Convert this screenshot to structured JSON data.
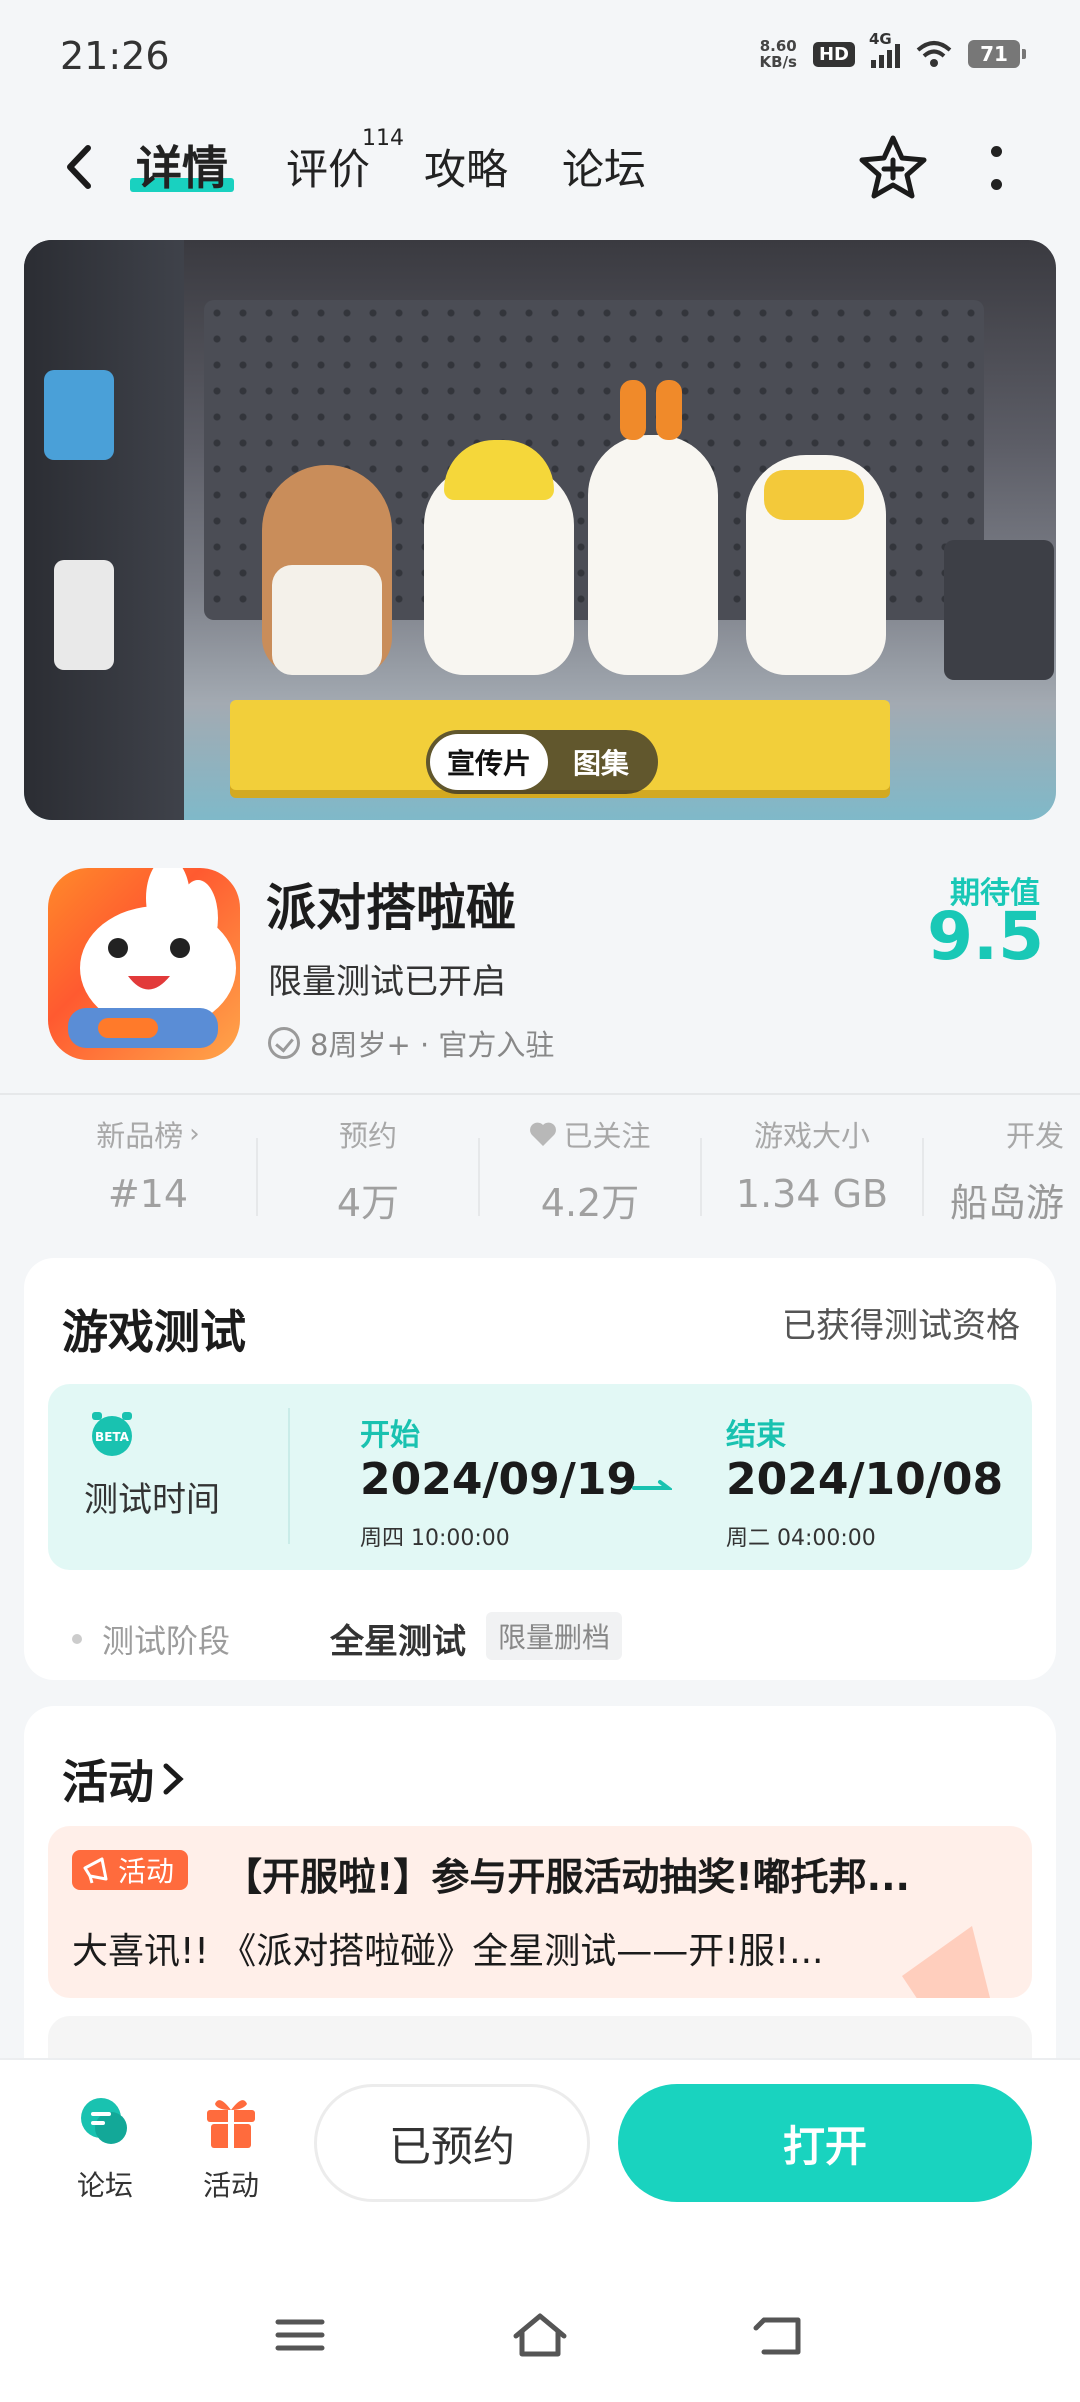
{
  "status": {
    "time": "21:26",
    "net_speed_value": "8.60",
    "net_speed_unit": "KB/s",
    "hd": "HD",
    "network": "4G",
    "battery": "71"
  },
  "nav": {
    "tabs": [
      {
        "label": "详情"
      },
      {
        "label": "评价"
      },
      {
        "label": "攻略"
      },
      {
        "label": "论坛"
      }
    ],
    "review_count": "114"
  },
  "banner": {
    "segment_video": "宣传片",
    "segment_gallery": "图集"
  },
  "game": {
    "title": "派对搭啦碰",
    "subtitle": "限量测试已开启",
    "tags": "8周岁+ · 官方入驻",
    "expect_label": "期待值",
    "expect_value": "9.5"
  },
  "stats": [
    {
      "label": "新品榜",
      "value": "#14"
    },
    {
      "label": "预约",
      "value": "4万"
    },
    {
      "label": "已关注",
      "value": "4.2万"
    },
    {
      "label": "游戏大小",
      "value": "1.34 GB"
    },
    {
      "label": "开发",
      "value": "船岛游"
    }
  ],
  "test": {
    "title": "游戏测试",
    "qualification": "已获得测试资格",
    "beta": "BETA",
    "time_label": "测试时间",
    "start_label": "开始",
    "start_date": "2024/09/19",
    "start_day": "周四  10:00:00",
    "end_label": "结束",
    "end_date": "2024/10/08",
    "end_day": "周二  04:00:00",
    "phase_label": "测试阶段",
    "phase_value": "全星测试",
    "phase_tag": "限量删档"
  },
  "activity": {
    "title": "活动",
    "badge": "活动",
    "item1_title": "【开服啦!】参与开服活动抽奖!嘟托邦...",
    "item1_desc": "大喜讯!! 《派对搭啦碰》全星测试——开!服!..."
  },
  "bottom": {
    "forum": "论坛",
    "activity": "活动",
    "reserved": "已预约",
    "open": "打开"
  },
  "colors": {
    "accent": "#19d3bf",
    "accent_text": "#19c2b0",
    "activity_orange": "#ff6b3d"
  }
}
